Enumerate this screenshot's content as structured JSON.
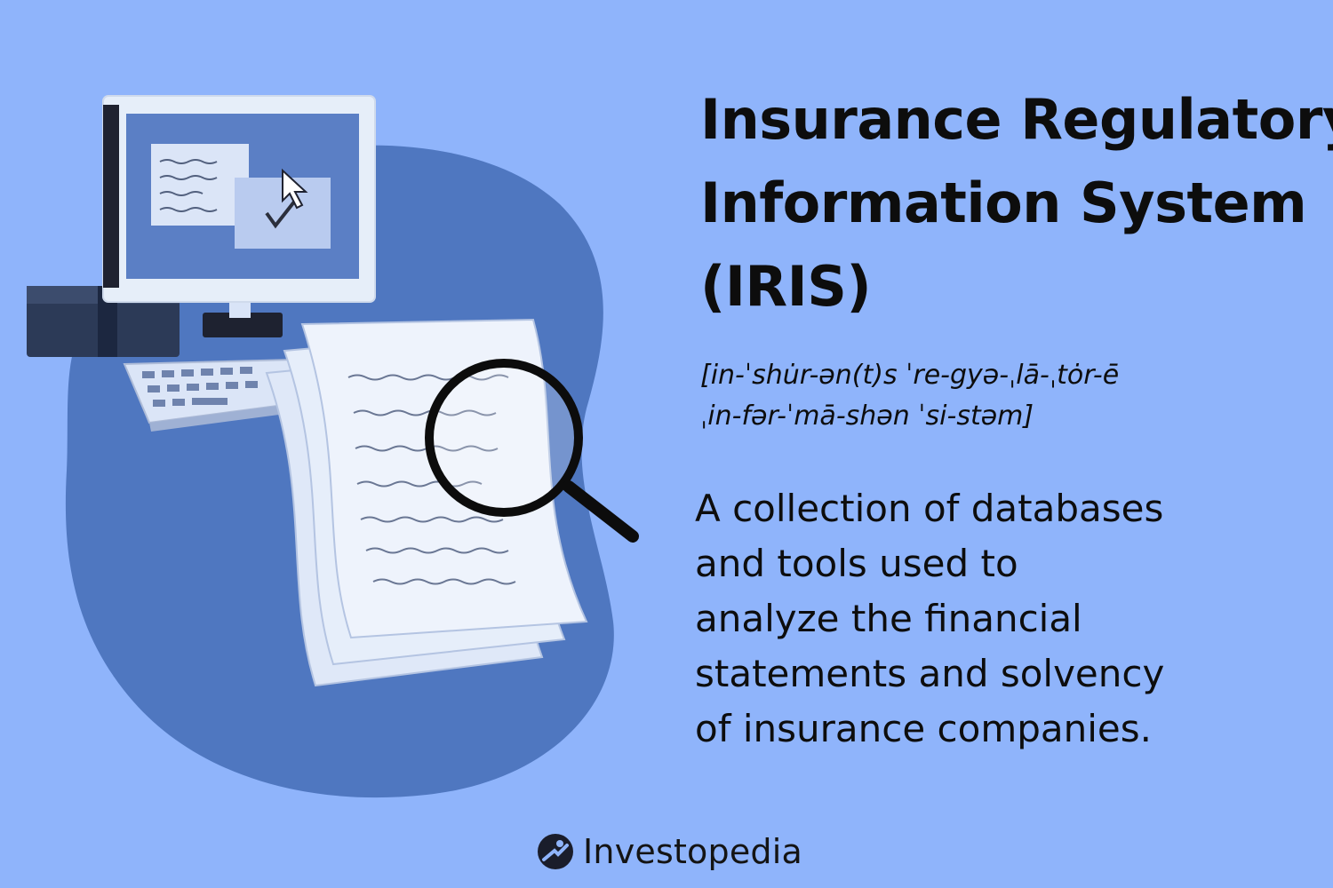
{
  "title_lines": [
    "Insurance Regulatory",
    "Information System",
    "(IRIS)"
  ],
  "pronunciation_lines": [
    "[in-ˈshu̇r-ən(t)s ˈre-gyə-ˌlā-ˌtȯr-ē",
    "ˌin-fər-ˈmā-shən ˈsi-stəm]"
  ],
  "definition_lines": [
    "A collection of databases",
    "and tools used to",
    "analyze the financial",
    "statements and solvency",
    "of insurance companies."
  ],
  "brand": {
    "name": "Investopedia",
    "icon": "investopedia-logo-icon"
  },
  "colors": {
    "background": "#8fb4fb",
    "blob": "#4f77c0",
    "text": "#0d0d0d"
  }
}
